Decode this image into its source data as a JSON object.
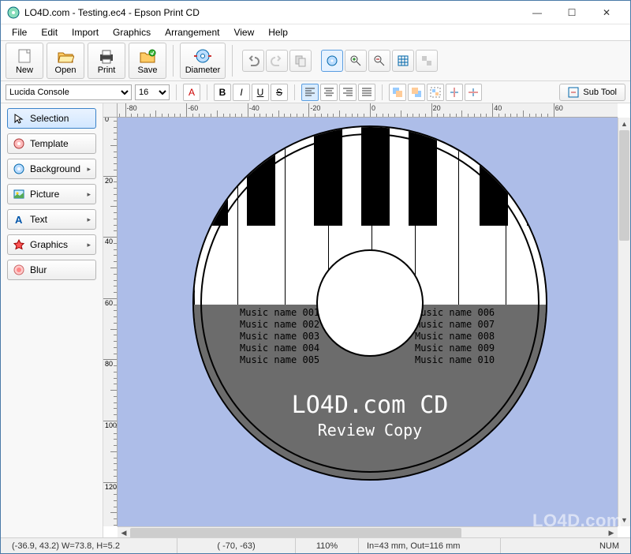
{
  "window": {
    "title": "LO4D.com - Testing.ec4 - Epson Print CD"
  },
  "menu": [
    "File",
    "Edit",
    "Import",
    "Graphics",
    "Arrangement",
    "View",
    "Help"
  ],
  "toolbar1": {
    "new": "New",
    "open": "Open",
    "print": "Print",
    "save": "Save",
    "diameter": "Diameter"
  },
  "toolbar2": {
    "font": "Lucida Console",
    "size": "16",
    "color_btn": "A",
    "bold": "B",
    "italic": "I",
    "underline": "U",
    "strike": "S",
    "subtool": "Sub Tool"
  },
  "sidebar": {
    "items": [
      {
        "label": "Selection",
        "has_sub": false,
        "active": true
      },
      {
        "label": "Template",
        "has_sub": false,
        "active": false
      },
      {
        "label": "Background",
        "has_sub": true,
        "active": false
      },
      {
        "label": "Picture",
        "has_sub": true,
        "active": false
      },
      {
        "label": "Text",
        "has_sub": true,
        "active": false
      },
      {
        "label": "Graphics",
        "has_sub": true,
        "active": false
      },
      {
        "label": "Blur",
        "has_sub": false,
        "active": false
      }
    ]
  },
  "ruler": {
    "h_labels": [
      "-80",
      "-60",
      "-40",
      "-20",
      "0",
      "20",
      "40"
    ],
    "v_labels": [
      "0",
      "20",
      "40",
      "60",
      "80",
      "100"
    ]
  },
  "disc": {
    "tracks_left": [
      "Music name 001",
      "Music name 002",
      "Music name 003",
      "Music name 004",
      "Music name 005"
    ],
    "tracks_right": [
      "Music name 006",
      "Music name 007",
      "Music name 008",
      "Music name 009",
      "Music name 010"
    ],
    "title": "LO4D.com CD",
    "subtitle": "Review Copy"
  },
  "status": {
    "coords": "(-36.9, 43.2) W=73.8, H=5.2",
    "mouse": "( -70, -63)",
    "zoom": "110%",
    "dims": "In=43 mm, Out=116 mm",
    "num": "NUM"
  },
  "watermark": "LO4D.com"
}
